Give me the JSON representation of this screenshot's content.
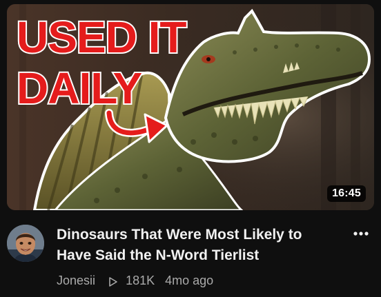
{
  "video": {
    "thumbnail": {
      "overlay_line1": "USED IT",
      "overlay_line2": "DAILY",
      "duration": "16:45",
      "overlay_color": "#e51c1c"
    },
    "title": "Dinosaurs That Were Most Likely to Have Said the N-Word Tierlist",
    "channel": "Jonesii",
    "views": "181K",
    "age": "4mo ago",
    "views_icon": "play-outline-icon",
    "menu_icon": "more-horizontal-icon"
  },
  "theme": {
    "background": "#0f0f0f",
    "title_color": "#f1f1f1",
    "secondary_text": "#aaaaaa"
  }
}
